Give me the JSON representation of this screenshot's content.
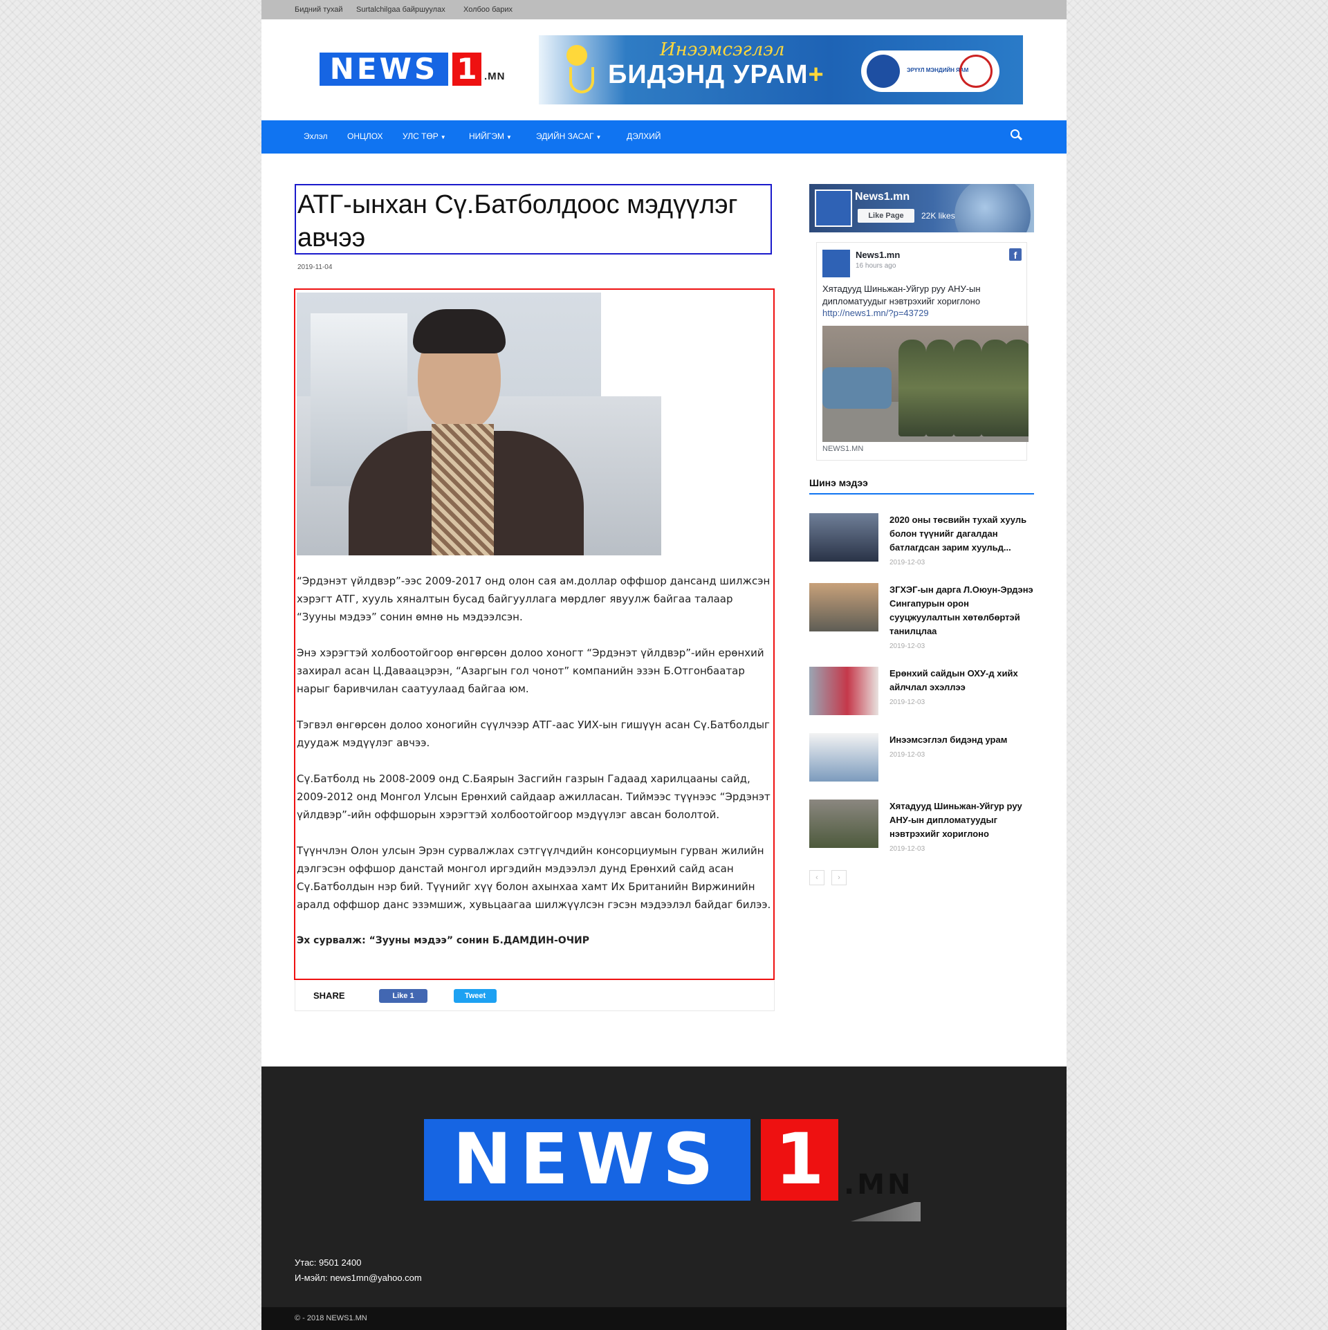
{
  "topbar": {
    "links": [
      "Бидний тухай",
      "Surtalchilgaa байршуулах",
      "Холбоо барих"
    ]
  },
  "header": {
    "logo_news": "NEWS",
    "logo_one": "1",
    "logo_mn": ".MN",
    "banner_sub": "Инээмсэглэл",
    "banner_main": "БИДЭНД УРАМ",
    "banner_plus": "+",
    "banner_ministry": "ЭРҮҮЛ МЭНДИЙН ЯАМ"
  },
  "nav": {
    "items": [
      "Эхлэл",
      "ОНЦЛОХ",
      "УЛС ТӨР",
      "НИЙГЭМ",
      "ЭДИЙН ЗАСАГ",
      "ДЭЛХИЙ"
    ]
  },
  "article": {
    "title": "АТГ-ынхан Сү.Батболдоос мэдүүлэг авчээ",
    "date": "2019-11-04",
    "paragraphs": [
      "“Эрдэнэт үйлдвэр”-ээс 2009-2017 онд олон сая ам.доллар  оффшор дансанд шилжсэн хэрэгт АТГ, хууль хяналтын бусад байгууллага мөрдлөг явуулж байгаа талаар “Зууны мэдээ” сонин өмнө нь мэдээлсэн.",
      "Энэ хэрэгтэй холбоотойгоор өнгөрсөн долоо хоногт “Эрдэнэт үйлдвэр”-ийн ерөнхий захирал асан Ц.Даваацэрэн, “Азаргын гол чонот” компанийн эзэн Б.Отгонбаатар нарыг баривчилан саатуулаад байгаа юм.",
      "Тэгвэл өнгөрсөн долоо хоногийн сүүлчээр АТГ-аас УИХ-ын гишүүн асан Сү.Батболдыг дуудаж мэдүүлэг авчээ.",
      "Сү.Батболд нь 2008-2009 онд С.Баярын Засгийн газрын Гадаад харилцааны сайд, 2009-2012 онд Монгол Улсын Ерөнхий  сайдаар ажилласан. Тиймээс түүнээс “Эрдэнэт үйлдвэр”-ийн оффшорын хэрэгтэй холбоотойгоор мэдүүлэг авсан бололтой.",
      "Түүнчлэн Олон улсын Эрэн сурвалжлах сэтгүүлчдийн консорциумын гурван жилийн дэлгэсэн оффшор данстай монгол иргэдийн мэдээлэл дунд Ерөнхий сайд асан Сү.Батболдын нэр бий. Түүнийг хүү болон ахынхаа хамт Их Британийн Виржинийн аралд оффшор данс эзэмшиж, хувьцаагаа шилжүүлсэн гэсэн мэдээлэл байдаг билээ."
    ],
    "source": "Эх сурвалж: “Зууны мэдээ” сонин Б.ДАМДИН-ОЧИР",
    "share_label": "SHARE",
    "fb_like": "Like 1",
    "tweet": "Tweet"
  },
  "facebook_widget": {
    "page_name": "News1.mn",
    "like_page": "Like Page",
    "likes": "22K likes",
    "post_author": "News1.mn",
    "post_time": "16 hours ago",
    "post_text": "Хятадууд Шиньжан-Уйгур руу АНУ-ын дипломатуудыг нэвтрэхийг хориглоно",
    "post_link": "http://news1.mn/?p=43729",
    "post_source": "NEWS1.MN"
  },
  "sidebar": {
    "heading": "Шинэ мэдээ",
    "news": [
      {
        "title": "2020 оны төсвийн тухай хууль болон түүнийг дагалдан батлагдсан зарим хуульд...",
        "date": "2019-12-03"
      },
      {
        "title": "ЗГХЭГ-ын дарга Л.Оюун-Эрдэнэ Сингапурын орон сууцжуулалтын хөтөлбөртэй танилцлаа",
        "date": "2019-12-03"
      },
      {
        "title": "Ерөнхий сайдын ОХУ-д хийх айлчлал эхэллээ",
        "date": "2019-12-03"
      },
      {
        "title": "Инээмсэглэл бидэнд урам",
        "date": "2019-12-03"
      },
      {
        "title": "Хятадууд Шиньжан-Уйгур руу АНУ-ын дипломатуудыг нэвтрэхийг хориглоно",
        "date": "2019-12-03"
      }
    ],
    "prev": "‹",
    "next": "›"
  },
  "footer": {
    "logo_news": "NEWS",
    "logo_one": "1",
    "logo_mn": ".MN",
    "phone": "Утас: 9501 2400",
    "email": "И-мэйл: news1mn@yahoo.com",
    "copyright": "© - 2018 NEWS1.MN"
  },
  "colors": {
    "nav_blue": "#1074f1",
    "logo_blue": "#1665e3",
    "logo_red": "#e11111",
    "footer_bg": "#222222"
  }
}
